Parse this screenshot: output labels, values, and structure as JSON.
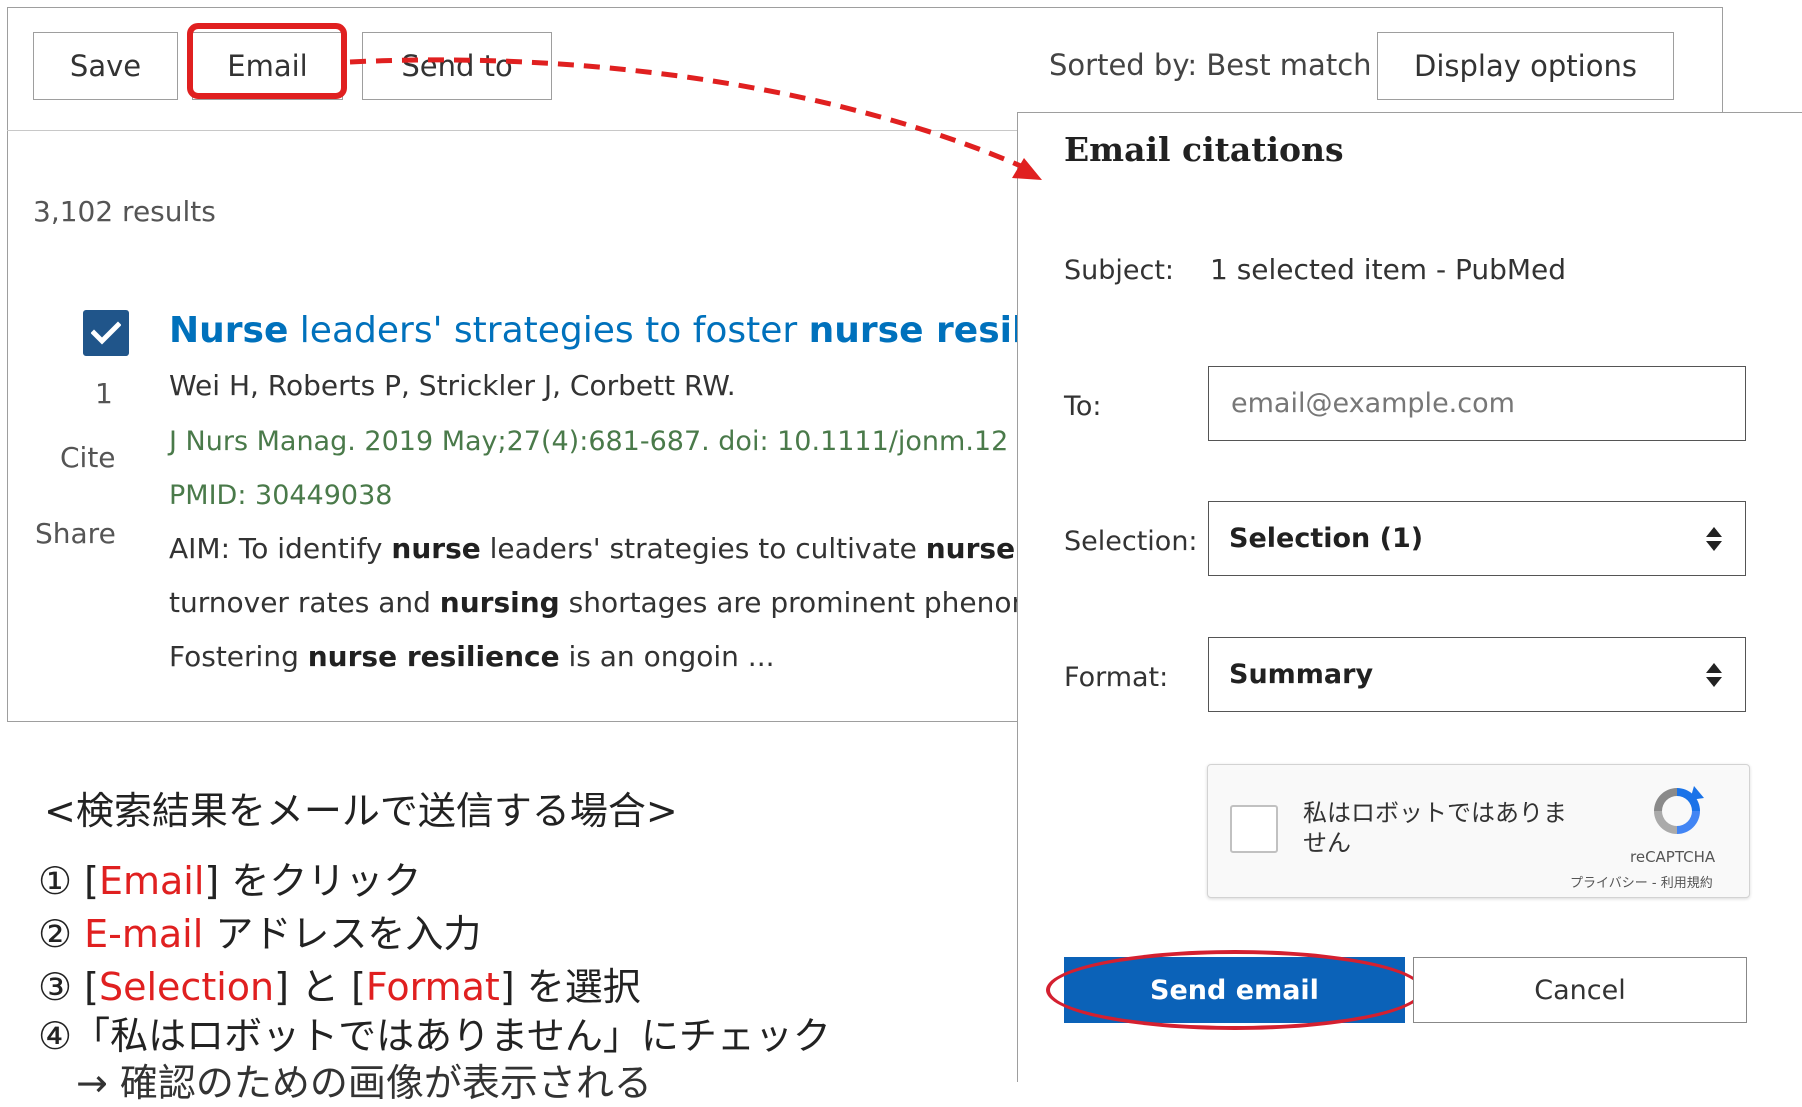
{
  "toolbar": {
    "save_label": "Save",
    "email_label": "Email",
    "send_to_label": "Send to",
    "sorted_by": "Sorted by: Best match",
    "display_options_label": "Display options"
  },
  "results": {
    "count": "3,102 results",
    "item": {
      "number": "1",
      "checked": true,
      "cite_label": "Cite",
      "share_label": "Share",
      "title_parts": [
        {
          "text": "Nurse",
          "bold": true
        },
        {
          "text": " leaders' strategies to foster ",
          "bold": false
        },
        {
          "text": "nurse resilie",
          "bold": true
        }
      ],
      "authors": "Wei H, Roberts P, Strickler J, Corbett RW.",
      "citation": "J Nurs Manag. 2019 May;27(4):681-687. doi: 10.1111/jonm.12",
      "pmid": "PMID: 30449038",
      "snippet_lines": [
        [
          {
            "text": "AIM: To identify ",
            "bold": false
          },
          {
            "text": "nurse",
            "bold": true
          },
          {
            "text": " leaders' strategies to cultivate ",
            "bold": false
          },
          {
            "text": "nurse r",
            "bold": true
          }
        ],
        [
          {
            "text": "turnover rates and ",
            "bold": false
          },
          {
            "text": "nursing",
            "bold": true
          },
          {
            "text": " shortages are prominent phenom",
            "bold": false
          }
        ],
        [
          {
            "text": "Fostering ",
            "bold": false
          },
          {
            "text": "nurse resilience",
            "bold": true
          },
          {
            "text": " is an ongoin ...",
            "bold": false
          }
        ]
      ]
    }
  },
  "email_dialog": {
    "title": "Email citations",
    "subject_label": "Subject:",
    "subject_value": "1 selected item - PubMed",
    "to_label": "To:",
    "to_placeholder": "email@example.com",
    "to_value": "",
    "selection_label": "Selection:",
    "selection_value": "Selection (1)",
    "format_label": "Format:",
    "format_value": "Summary",
    "recaptcha": {
      "checkbox_text": "私はロボットではありません",
      "brand": "reCAPTCHA",
      "links": "プライバシー - 利用規約"
    },
    "send_label": "Send email",
    "cancel_label": "Cancel"
  },
  "instructions": {
    "title": "<検索結果をメールで送信する場合>",
    "steps": [
      [
        {
          "text": "① [",
          "red": false
        },
        {
          "text": "Email",
          "red": true
        },
        {
          "text": "] をクリック",
          "red": false
        }
      ],
      [
        {
          "text": "② ",
          "red": false
        },
        {
          "text": "E-mail",
          "red": true
        },
        {
          "text": " アドレスを入力",
          "red": false
        }
      ],
      [
        {
          "text": "③ [",
          "red": false
        },
        {
          "text": "Selection",
          "red": true
        },
        {
          "text": "] と [",
          "red": false
        },
        {
          "text": "Format",
          "red": true
        },
        {
          "text": "] を選択",
          "red": false
        }
      ],
      [
        {
          "text": "④「私はロボットではありません」にチェック",
          "red": false
        }
      ],
      [
        {
          "text": "　→ 確認のための画像が表示される",
          "red": false
        }
      ]
    ]
  },
  "colors": {
    "link_blue": "#0071bc",
    "checkbox_blue": "#20558a",
    "send_button_blue": "#0b62b8",
    "annotation_red": "#e02020",
    "citation_green": "#4a7a4a"
  },
  "icons": {
    "checkbox": "checkmark-icon",
    "select_arrows": "updown-arrows-icon",
    "recaptcha": "recaptcha-logo-icon",
    "arrow": "dashed-arrow-icon"
  }
}
